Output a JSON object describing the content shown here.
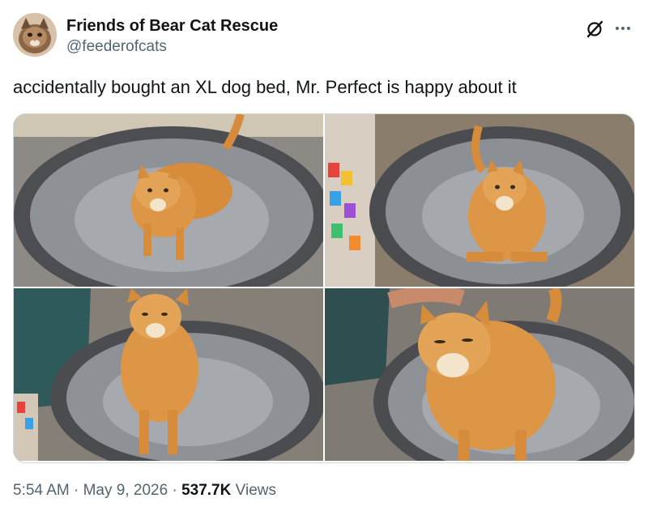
{
  "author": {
    "display_name": "Friends of Bear Cat Rescue",
    "handle": "@feederofcats"
  },
  "tweet": {
    "text": "accidentally bought an XL dog bed, Mr. Perfect is happy about it"
  },
  "media": {
    "photo_count": 4
  },
  "meta": {
    "time": "5:54 AM",
    "separator": "·",
    "date": "May 9, 2026",
    "views_count": "537.7K",
    "views_label": "Views"
  },
  "icons": {
    "grok": "grok-icon",
    "more": "more-icon"
  },
  "colors": {
    "text_primary": "#0f1419",
    "text_secondary": "#536471",
    "border": "#cfd9de"
  }
}
